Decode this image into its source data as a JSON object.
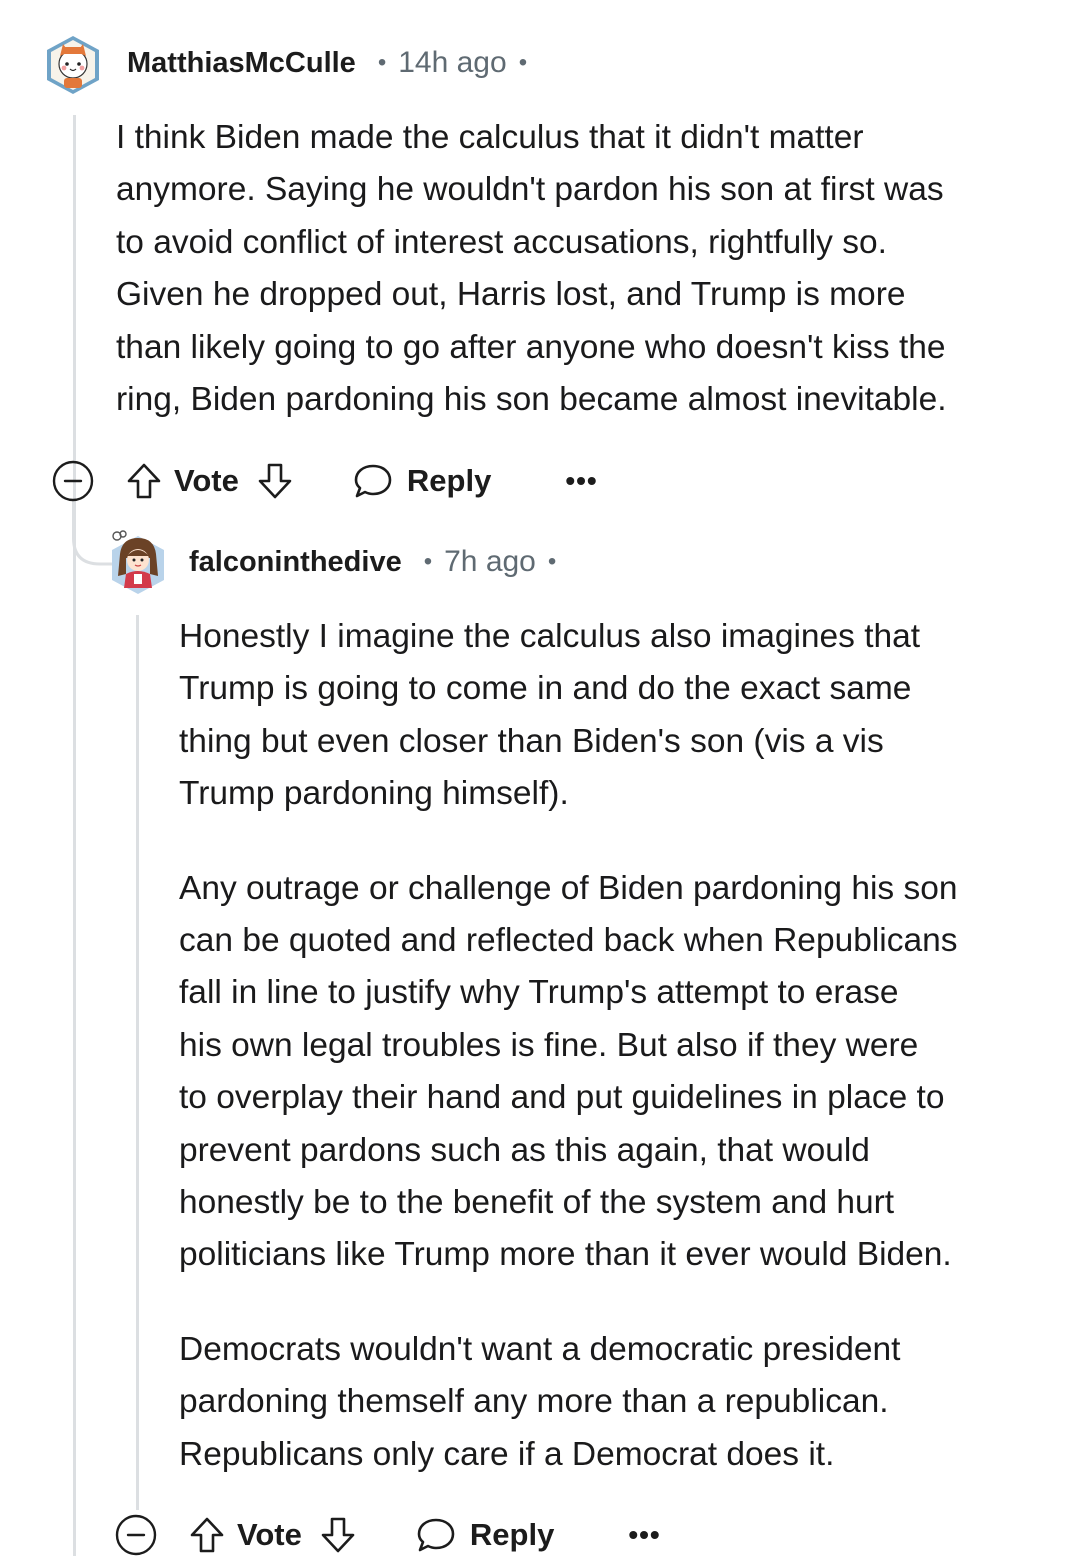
{
  "comments": [
    {
      "username": "MatthiasMcCulle",
      "time": "14h ago",
      "paragraphs": [
        [
          "I think Biden made the calculus that it didn't matter",
          "anymore. Saying he wouldn't pardon his son at first was",
          "to avoid conflict of interest accusations, rightfully so.",
          "Given he dropped out, Harris lost, and Trump is more",
          "than likely going to go after anyone who doesn't kiss the",
          "ring, Biden pardoning his son became almost inevitable."
        ]
      ],
      "actions": {
        "vote": "Vote",
        "reply": "Reply",
        "more": "•••"
      }
    },
    {
      "username": "falconinthedive",
      "time": "7h ago",
      "paragraphs": [
        [
          "Honestly I imagine the calculus also imagines that",
          "Trump is going to come in and do the exact same",
          "thing but even closer than Biden's son (vis a vis",
          "Trump pardoning himself)."
        ],
        [
          "Any outrage or challenge of Biden pardoning his son",
          "can be quoted and reflected back when Republicans",
          "fall in line to justify why Trump's attempt to erase",
          "his own legal troubles is fine. But also if they were",
          "to overplay their hand and put guidelines in place to",
          "prevent pardons such as this again, that would",
          "honestly be to the benefit of the system and hurt",
          "politicians like Trump more than it ever would Biden."
        ],
        [
          "Democrats wouldn't want a democratic president",
          "pardoning themself any more than a republican.",
          "Republicans only care if a Democrat does it."
        ]
      ],
      "actions": {
        "vote": "Vote",
        "reply": "Reply",
        "more": "•••"
      }
    }
  ],
  "meta_separator": "•",
  "icons": {
    "collapse": "minus-circle-icon",
    "upvote": "arrow-up-icon",
    "downvote": "arrow-down-icon",
    "reply": "speech-bubble-icon",
    "avatar1": "cat-avatar-icon",
    "avatar2": "girl-avatar-icon"
  },
  "colors": {
    "text": "#1a1a1b",
    "muted": "#5f6a72",
    "thread_line": "#dcdfe2"
  }
}
